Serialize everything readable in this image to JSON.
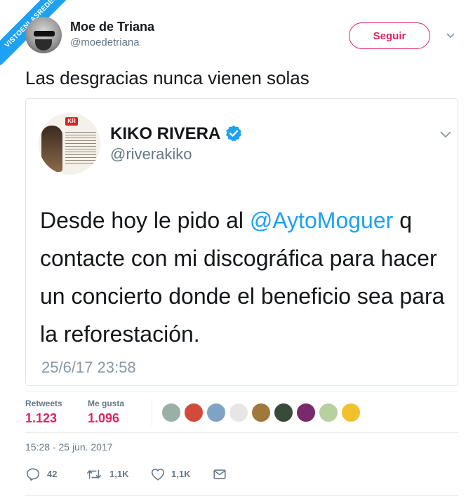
{
  "watermark": {
    "text": "VISTOENLASREDES"
  },
  "author": {
    "display_name": "Moe de Triana",
    "handle": "@moedetriana",
    "follow_label": "Seguir"
  },
  "tweet": {
    "text": "Las desgracias nunca vienen solas"
  },
  "quoted_tweet": {
    "display_name": "KIKO RIVERA",
    "handle": "@riverakiko",
    "avatar_badge": "KR",
    "text_before": "Desde hoy le pido al ",
    "mention": "@AytoMoguer",
    "text_after": " q contacte con mi discográfica para hacer un concierto donde el beneficio sea para la reforestación.",
    "date": "25/6/17 23:58"
  },
  "stats": {
    "retweets_label": "Retweets",
    "retweets_value": "1.123",
    "likes_label": "Me gusta",
    "likes_value": "1.096"
  },
  "liker_avatars": [
    "#9ab0a6",
    "#d24a3a",
    "#7fa3c4",
    "#e6e6e6",
    "#a0783c",
    "#3a4a3a",
    "#7a2a6a",
    "#b8d0a0",
    "#f2c12e"
  ],
  "timestamp": "15:28 - 25 jun. 2017",
  "actions": {
    "reply_count": "42",
    "retweet_count": "1,1K",
    "like_count": "1,1K"
  },
  "colors": {
    "accent_red": "#e0245e",
    "link_blue": "#1da1f2",
    "muted": "#657786"
  }
}
